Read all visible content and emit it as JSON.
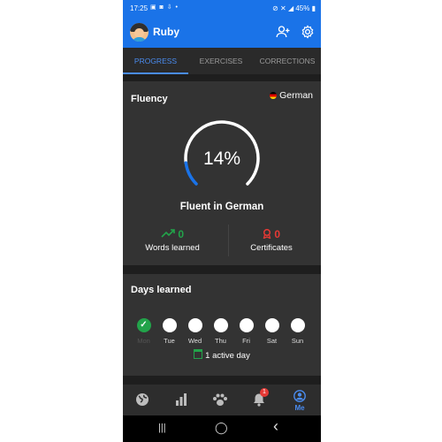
{
  "status_bar": {
    "time": "17:25",
    "left_icons": "▣ ◙ ⇩ •",
    "right": "⊘ ✕ ◢ 45% ▮"
  },
  "app_bar": {
    "name": "Ruby",
    "add_user_icon": "add-person",
    "settings_icon": "gear"
  },
  "tabs": [
    {
      "label": "PROGRESS",
      "active": true
    },
    {
      "label": "EXERCISES",
      "active": false
    },
    {
      "label": "CORRECTIONS",
      "active": false
    }
  ],
  "fluency": {
    "title": "Fluency",
    "language": "German",
    "percent_label": "14%",
    "percent": 14,
    "subtitle": "Fluent in German",
    "words_value": "0",
    "words_label": "Words learned",
    "certificates_value": "0",
    "certificates_label": "Certificates"
  },
  "days_learned": {
    "title": "Days learned",
    "days": [
      {
        "label": "Mon",
        "done": true
      },
      {
        "label": "Tue",
        "done": false
      },
      {
        "label": "Wed",
        "done": false
      },
      {
        "label": "Thu",
        "done": false
      },
      {
        "label": "Fri",
        "done": false
      },
      {
        "label": "Sat",
        "done": false
      },
      {
        "label": "Sun",
        "done": false
      }
    ],
    "active_days": "1 active day"
  },
  "bottom_nav": {
    "items": [
      "community",
      "progress-chart",
      "friends",
      "notifications",
      "Me"
    ],
    "notification_badge": "1",
    "me_label": "Me"
  },
  "system_nav": {
    "recents": "|||",
    "home": "◯",
    "back": "‹"
  },
  "colors": {
    "accent": "#1a73e8",
    "active_tab": "#4a8cf0",
    "green": "#22a34a",
    "red": "#e53935",
    "card": "#333333",
    "background": "#1e1e1e"
  }
}
